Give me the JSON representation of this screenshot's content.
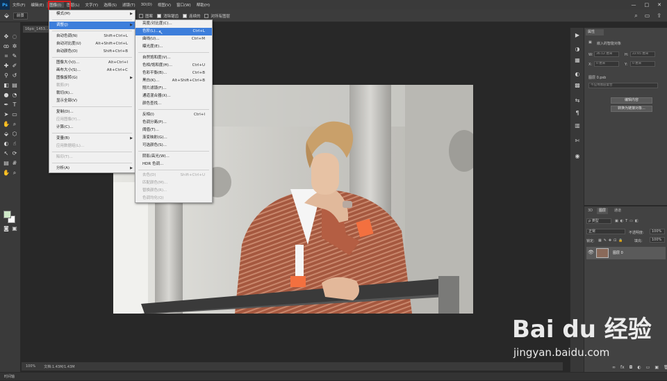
{
  "menubar": {
    "logo": "Ps",
    "items": [
      "文件(F)",
      "编辑(E)",
      "图像(I)",
      "图层(L)",
      "文字(Y)",
      "选择(S)",
      "滤镜(T)",
      "3D(D)",
      "视图(V)",
      "窗口(W)",
      "帮助(H)"
    ],
    "window_controls": [
      "—",
      "□",
      "✕"
    ]
  },
  "optionsbar": {
    "preset": "前景",
    "opt1_label": "图案",
    "opt2_label": "消除锯齿",
    "opt3_label": "连续的",
    "opt4_label": "对所有图层"
  },
  "document": {
    "tab": "16pic_1453...",
    "zoom": "100%",
    "doc_info": "文档:1.43M/1.43M"
  },
  "timeline_tab": "时间轴",
  "image_menu": {
    "items": [
      {
        "label": "模式(M)",
        "shortcut": "",
        "submenu": true,
        "disabled": false,
        "highlight": false
      },
      {
        "sep": true
      },
      {
        "label": "调整(J)",
        "shortcut": "",
        "submenu": true,
        "disabled": false,
        "highlight": true
      },
      {
        "sep": true
      },
      {
        "label": "自动色调(N)",
        "shortcut": "Shift+Ctrl+L",
        "submenu": false,
        "disabled": false,
        "highlight": false
      },
      {
        "label": "自动对比度(U)",
        "shortcut": "Alt+Shift+Ctrl+L",
        "submenu": false,
        "disabled": false,
        "highlight": false
      },
      {
        "label": "自动颜色(O)",
        "shortcut": "Shift+Ctrl+B",
        "submenu": false,
        "disabled": false,
        "highlight": false
      },
      {
        "sep": true
      },
      {
        "label": "图像大小(I)...",
        "shortcut": "Alt+Ctrl+I",
        "submenu": false,
        "disabled": false,
        "highlight": false
      },
      {
        "label": "画布大小(S)...",
        "shortcut": "Alt+Ctrl+C",
        "submenu": false,
        "disabled": false,
        "highlight": false
      },
      {
        "label": "图像旋转(G)",
        "shortcut": "",
        "submenu": true,
        "disabled": false,
        "highlight": false
      },
      {
        "label": "裁剪(P)",
        "shortcut": "",
        "submenu": false,
        "disabled": true,
        "highlight": false
      },
      {
        "label": "裁切(R)...",
        "shortcut": "",
        "submenu": false,
        "disabled": false,
        "highlight": false
      },
      {
        "label": "显示全部(V)",
        "shortcut": "",
        "submenu": false,
        "disabled": false,
        "highlight": false
      },
      {
        "sep": true
      },
      {
        "label": "复制(D)...",
        "shortcut": "",
        "submenu": false,
        "disabled": false,
        "highlight": false
      },
      {
        "label": "应用图像(Y)...",
        "shortcut": "",
        "submenu": false,
        "disabled": true,
        "highlight": false
      },
      {
        "label": "计算(C)...",
        "shortcut": "",
        "submenu": false,
        "disabled": false,
        "highlight": false
      },
      {
        "sep": true
      },
      {
        "label": "变量(B)",
        "shortcut": "",
        "submenu": true,
        "disabled": false,
        "highlight": false
      },
      {
        "label": "应用数据组(L)...",
        "shortcut": "",
        "submenu": false,
        "disabled": true,
        "highlight": false
      },
      {
        "sep": true
      },
      {
        "label": "陷印(T)...",
        "shortcut": "",
        "submenu": false,
        "disabled": true,
        "highlight": false
      },
      {
        "sep": true
      },
      {
        "label": "分析(A)",
        "shortcut": "",
        "submenu": true,
        "disabled": false,
        "highlight": false
      }
    ]
  },
  "adjust_menu": {
    "items": [
      {
        "label": "亮度/对比度(C)...",
        "shortcut": "",
        "disabled": false,
        "highlight": false
      },
      {
        "label": "色阶(L)...",
        "shortcut": "Ctrl+L",
        "disabled": false,
        "highlight": true
      },
      {
        "label": "曲线(U)...",
        "shortcut": "Ctrl+M",
        "disabled": false,
        "highlight": false
      },
      {
        "label": "曝光度(E)...",
        "shortcut": "",
        "disabled": false,
        "highlight": false
      },
      {
        "sep": true
      },
      {
        "label": "自然饱和度(V)...",
        "shortcut": "",
        "disabled": false,
        "highlight": false
      },
      {
        "label": "色相/饱和度(H)...",
        "shortcut": "Ctrl+U",
        "disabled": false,
        "highlight": false
      },
      {
        "label": "色彩平衡(B)...",
        "shortcut": "Ctrl+B",
        "disabled": false,
        "highlight": false
      },
      {
        "label": "黑白(K)...",
        "shortcut": "Alt+Shift+Ctrl+B",
        "disabled": false,
        "highlight": false
      },
      {
        "label": "照片滤镜(F)...",
        "shortcut": "",
        "disabled": false,
        "highlight": false
      },
      {
        "label": "通道混合器(X)...",
        "shortcut": "",
        "disabled": false,
        "highlight": false
      },
      {
        "label": "颜色查找...",
        "shortcut": "",
        "disabled": false,
        "highlight": false
      },
      {
        "sep": true
      },
      {
        "label": "反相(I)",
        "shortcut": "Ctrl+I",
        "disabled": false,
        "highlight": false
      },
      {
        "label": "色调分离(P)...",
        "shortcut": "",
        "disabled": false,
        "highlight": false
      },
      {
        "label": "阈值(T)...",
        "shortcut": "",
        "disabled": false,
        "highlight": false
      },
      {
        "label": "渐变映射(G)...",
        "shortcut": "",
        "disabled": false,
        "highlight": false
      },
      {
        "label": "可选颜色(S)...",
        "shortcut": "",
        "disabled": false,
        "highlight": false
      },
      {
        "sep": true
      },
      {
        "label": "阴影/高光(W)...",
        "shortcut": "",
        "disabled": false,
        "highlight": false
      },
      {
        "label": "HDR 色调...",
        "shortcut": "",
        "disabled": false,
        "highlight": false
      },
      {
        "sep": true
      },
      {
        "label": "去色(D)",
        "shortcut": "Shift+Ctrl+U",
        "disabled": true,
        "highlight": false
      },
      {
        "label": "匹配颜色(M)...",
        "shortcut": "",
        "disabled": true,
        "highlight": false
      },
      {
        "label": "替换颜色(R)...",
        "shortcut": "",
        "disabled": true,
        "highlight": false
      },
      {
        "label": "色调均化(Q)",
        "shortcut": "",
        "disabled": true,
        "highlight": false
      }
    ]
  },
  "properties": {
    "tab": "属性",
    "type": "嵌入的智能对象",
    "w_label": "W:",
    "w_value": "36.12 厘米",
    "h_label": "H:",
    "h_value": "22.65 厘米",
    "x_label": "X:",
    "x_value": "0 厘米",
    "y_label": "Y:",
    "y_value": "0 厘米",
    "file_label": "图层 0.psb",
    "comp_placeholder": "不应用图层复合",
    "edit_btn": "编辑内容",
    "convert_btn": "转换为链接对象..."
  },
  "layers": {
    "tabs": [
      "3D",
      "图层",
      "通道"
    ],
    "filter": "ρ 类型",
    "blend": "正常",
    "opacity_label": "不透明度:",
    "opacity": "100%",
    "lock_label": "锁定:",
    "fill_label": "填充:",
    "fill": "100%",
    "layer_name": "图层 0",
    "bottom_icons": [
      "∞",
      "fx",
      "◘",
      "◐",
      "▭",
      "▣",
      "🗑"
    ]
  },
  "watermark": {
    "logo": "Bai du 经验",
    "url": "jingyan.baidu.com"
  },
  "colors": {
    "highlight": "#3d7edb",
    "red_box": "#e01e1e",
    "foreground_swatch": "#cfe8c8",
    "background_swatch": "#ffffff"
  }
}
